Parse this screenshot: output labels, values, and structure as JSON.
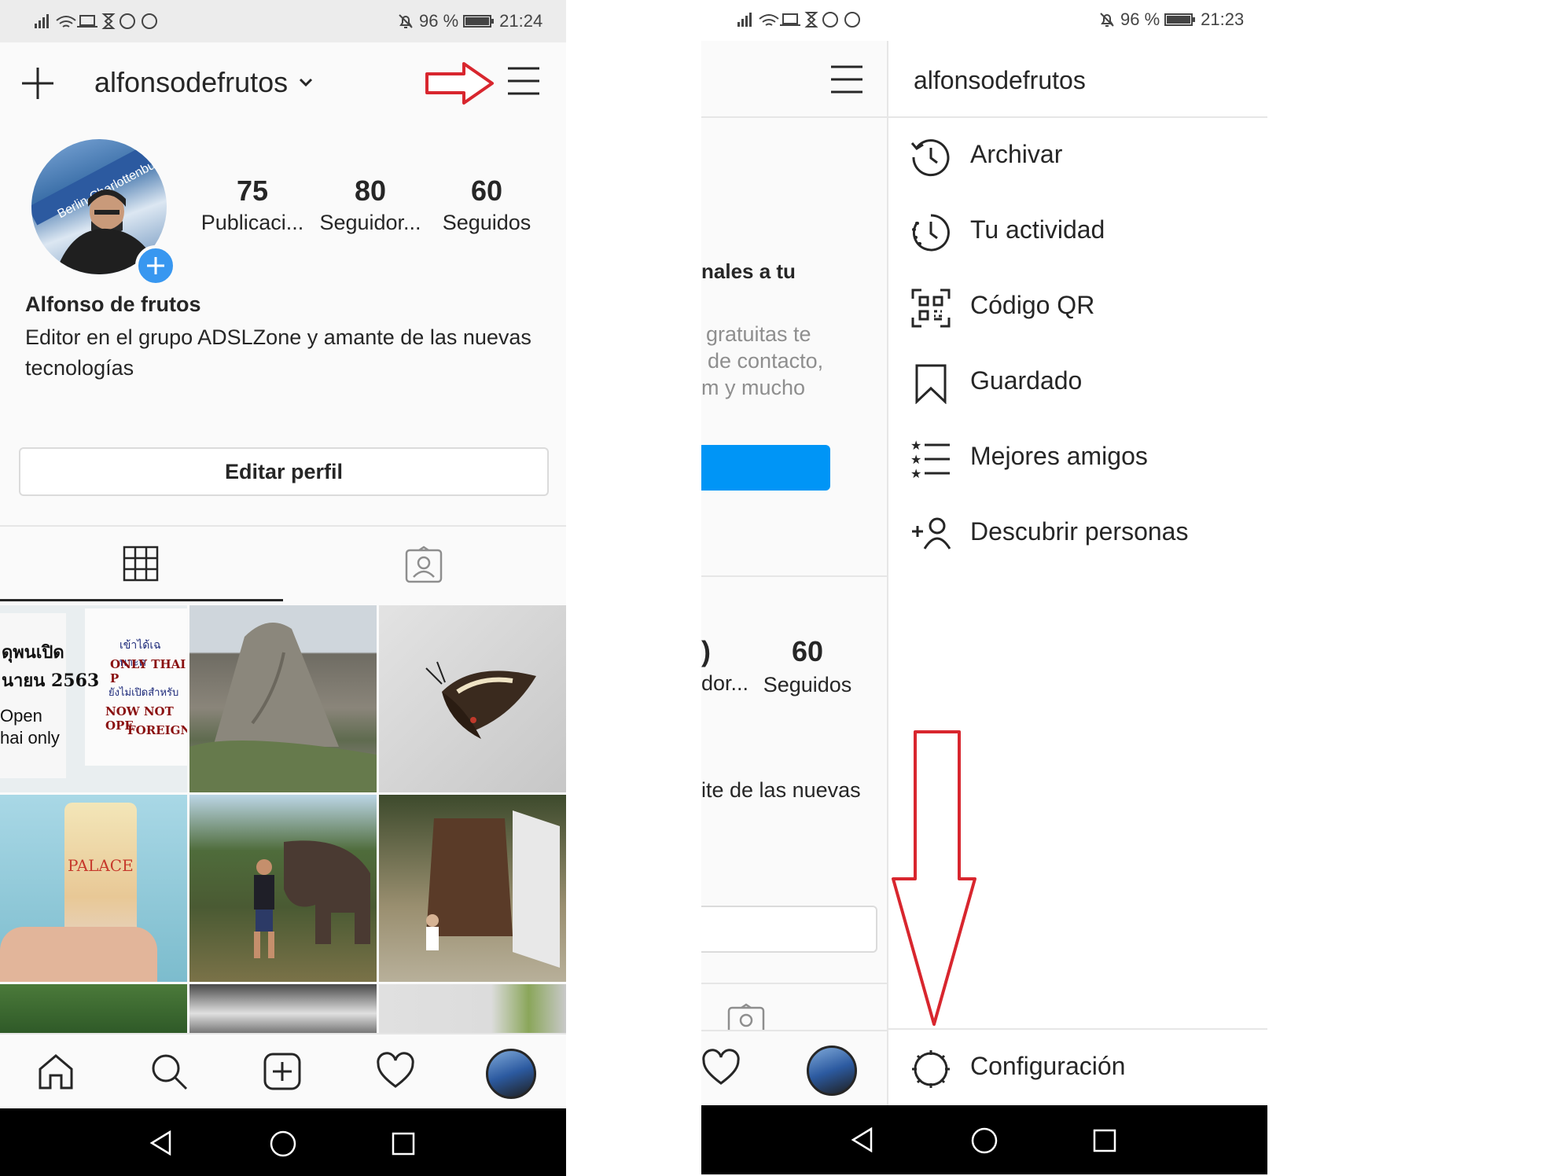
{
  "left": {
    "status": {
      "battery_pct": "96 %",
      "time": "21:24"
    },
    "header": {
      "username": "alfonsodefrutos"
    },
    "stats": [
      {
        "value": "75",
        "label": "Publicaci..."
      },
      {
        "value": "80",
        "label": "Seguidor..."
      },
      {
        "value": "60",
        "label": "Seguidos"
      }
    ],
    "profile": {
      "name": "Alfonso de frutos",
      "bio": "Editor en el grupo ADSLZone y amante de las nuevas tecnologías"
    },
    "edit_button": "Editar perfil",
    "grid_texts": {
      "t1a": "ดุพนเปิด",
      "t1b": "นายน 2563",
      "t1c": "Open",
      "t1d": "hai only",
      "t2a": "เข้าได้เฉพาะค",
      "t2b": "ONLY THAI P",
      "t2c": "ยังไม่เปิดสำหรับ",
      "t2d": "NOW NOT OPE",
      "t2e": "FOREIGNE",
      "palace": "PALACE"
    }
  },
  "right": {
    "status": {
      "battery_pct": "96 %",
      "time": "21:23"
    },
    "drawer_username": "alfonsodefrutos",
    "menu": [
      {
        "label": "Archivar",
        "icon": "archive-clock-icon"
      },
      {
        "label": "Tu actividad",
        "icon": "activity-clock-icon"
      },
      {
        "label": "Código QR",
        "icon": "qr-code-icon"
      },
      {
        "label": "Guardado",
        "icon": "bookmark-icon"
      },
      {
        "label": "Mejores amigos",
        "icon": "close-friends-list-icon"
      },
      {
        "label": "Descubrir personas",
        "icon": "add-person-icon"
      }
    ],
    "settings_label": "Configuración",
    "behind": {
      "heading": "nales a tu",
      "line1": "gratuitas te",
      "line2": "de contacto,",
      "line3": "m y mucho",
      "stat_partial_value": ")",
      "stat_partial_label": "dor...",
      "stat_value": "60",
      "stat_label": "Seguidos",
      "bio_fragment": "ite de las nuevas"
    }
  },
  "colors": {
    "accent_blue": "#0095f6",
    "annotation_red": "#d8262e",
    "panel_bg": "#fafafa"
  }
}
